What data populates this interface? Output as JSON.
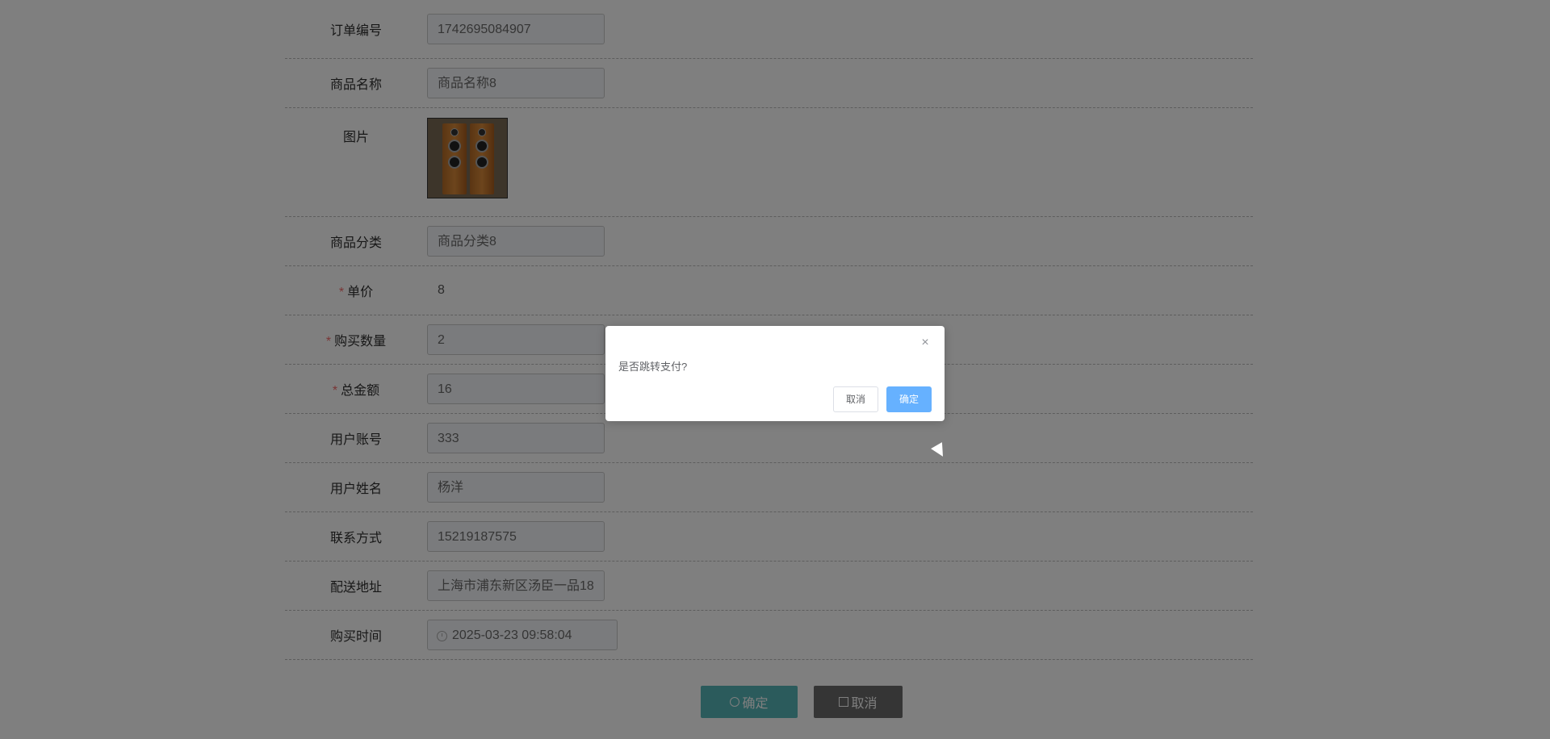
{
  "form": {
    "order_no": {
      "label": "订单编号",
      "value": "1742695084907"
    },
    "product_name": {
      "label": "商品名称",
      "value": "商品名称8"
    },
    "image": {
      "label": "图片"
    },
    "category": {
      "label": "商品分类",
      "value": "商品分类8"
    },
    "unit_price": {
      "label": "单价",
      "value": "8",
      "required": "*"
    },
    "quantity": {
      "label": "购买数量",
      "value": "2",
      "required": "*"
    },
    "total": {
      "label": "总金额",
      "value": "16",
      "required": "*"
    },
    "account": {
      "label": "用户账号",
      "value": "333"
    },
    "user_name": {
      "label": "用户姓名",
      "value": "杨洋"
    },
    "phone": {
      "label": "联系方式",
      "value": "15219187575"
    },
    "address": {
      "label": "配送地址",
      "value": "上海市浦东新区汤臣一品18"
    },
    "purchase_time": {
      "label": "购买时间",
      "value": "2025-03-23 09:58:04"
    }
  },
  "actions": {
    "ok_label": "确定",
    "cancel_label": "取消"
  },
  "dialog": {
    "message": "是否跳转支付?",
    "close_icon": "×",
    "cancel_label": "取消",
    "ok_label": "确定"
  },
  "colors": {
    "ok_button": "#56b7b8",
    "cancel_button": "#6a6a6a",
    "dialog_primary": "#66b1ff",
    "required_star": "#f56c6c"
  }
}
